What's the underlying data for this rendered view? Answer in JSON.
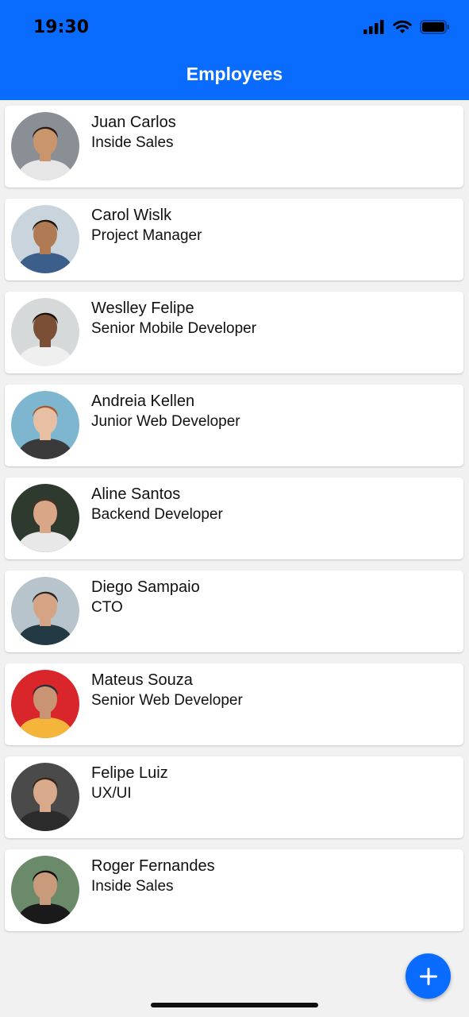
{
  "status_bar": {
    "time": "19:30"
  },
  "header": {
    "title": "Employees"
  },
  "employees": [
    {
      "name": "Juan Carlos",
      "role": "Inside Sales",
      "skin": "#c8956c",
      "hair": "#2a1a12",
      "bg": "#8a8f96",
      "shirt": "#e6e6e6"
    },
    {
      "name": "Carol Wislk",
      "role": "Project Manager",
      "skin": "#b07a55",
      "hair": "#1c1410",
      "bg": "#c9d4dc",
      "shirt": "#3b5f8a"
    },
    {
      "name": "Weslley Felipe",
      "role": "Senior Mobile Developer",
      "skin": "#7a4f35",
      "hair": "#1a120e",
      "bg": "#d6d9da",
      "shirt": "#efefef"
    },
    {
      "name": "Andreia Kellen",
      "role": "Junior Web Developer",
      "skin": "#e7c0a4",
      "hair": "#a55a2f",
      "bg": "#7fb6cf",
      "shirt": "#3a3a3a"
    },
    {
      "name": "Aline Santos",
      "role": "Backend Developer",
      "skin": "#d9a787",
      "hair": "#4a3020",
      "bg": "#2e3a2e",
      "shirt": "#e8e8e8"
    },
    {
      "name": "Diego Sampaio",
      "role": "CTO",
      "skin": "#d4a485",
      "hair": "#2b2420",
      "bg": "#b8c4cc",
      "shirt": "#233a44"
    },
    {
      "name": "Mateus Souza",
      "role": "Senior Web Developer",
      "skin": "#c99473",
      "hair": "#2a2f3a",
      "bg": "#d8262b",
      "shirt": "#f5b53a"
    },
    {
      "name": "Felipe Luiz",
      "role": "UX/UI",
      "skin": "#d9a98c",
      "hair": "#3a2418",
      "bg": "#4a4a4a",
      "shirt": "#2c2c2c"
    },
    {
      "name": "Roger Fernandes",
      "role": "Inside Sales",
      "skin": "#c99a7c",
      "hair": "#0f0c0b",
      "bg": "#6b8a6a",
      "shirt": "#1a1a1a"
    }
  ],
  "fab": {
    "icon": "plus-icon"
  },
  "colors": {
    "accent": "#0a6cff",
    "background": "#f1f1f1"
  }
}
